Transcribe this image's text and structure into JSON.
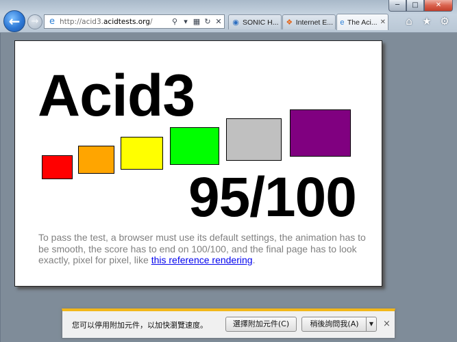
{
  "browser": {
    "address": {
      "url_prefix": "http://acid3.",
      "url_domain": "acidtests.org",
      "url_suffix": "/"
    },
    "tabs": [
      {
        "label": "SONIC H...",
        "icon": "globe-icon",
        "active": false
      },
      {
        "label": "Internet E...",
        "icon": "windows-flag-icon",
        "active": false
      },
      {
        "label": "The Aci...",
        "icon": "ie-logo-icon",
        "active": true
      }
    ],
    "caption": {
      "minimize": "─",
      "maximize": "□",
      "close": "✕"
    },
    "toolbar_icons": [
      "home-icon",
      "favorites-star-icon",
      "tools-gear-icon"
    ]
  },
  "page": {
    "title": "Acid3",
    "score": "95/100",
    "instructions": "To pass the test, a browser must use its default settings, the animation has to be smooth, the score has to end on 100/100, and the final page has to look exactly, pixel for pixel, like ",
    "reference_link": "this reference rendering",
    "trailing": ".",
    "buckets": [
      {
        "name": "bucket-red",
        "color": "#ff0000"
      },
      {
        "name": "bucket-orange",
        "color": "#ffa500"
      },
      {
        "name": "bucket-yellow",
        "color": "#ffff00"
      },
      {
        "name": "bucket-lime",
        "color": "#00ff00"
      },
      {
        "name": "bucket-silver",
        "color": "#c0c0c0"
      },
      {
        "name": "bucket-purple",
        "color": "#800080"
      }
    ]
  },
  "notification": {
    "message": "您可以停用附加元件，以加快瀏覽速度。",
    "choose_button": "選擇附加元件(C)",
    "later_button": "稍後詢問我(A)",
    "dropdown": "▼",
    "close": "×"
  }
}
